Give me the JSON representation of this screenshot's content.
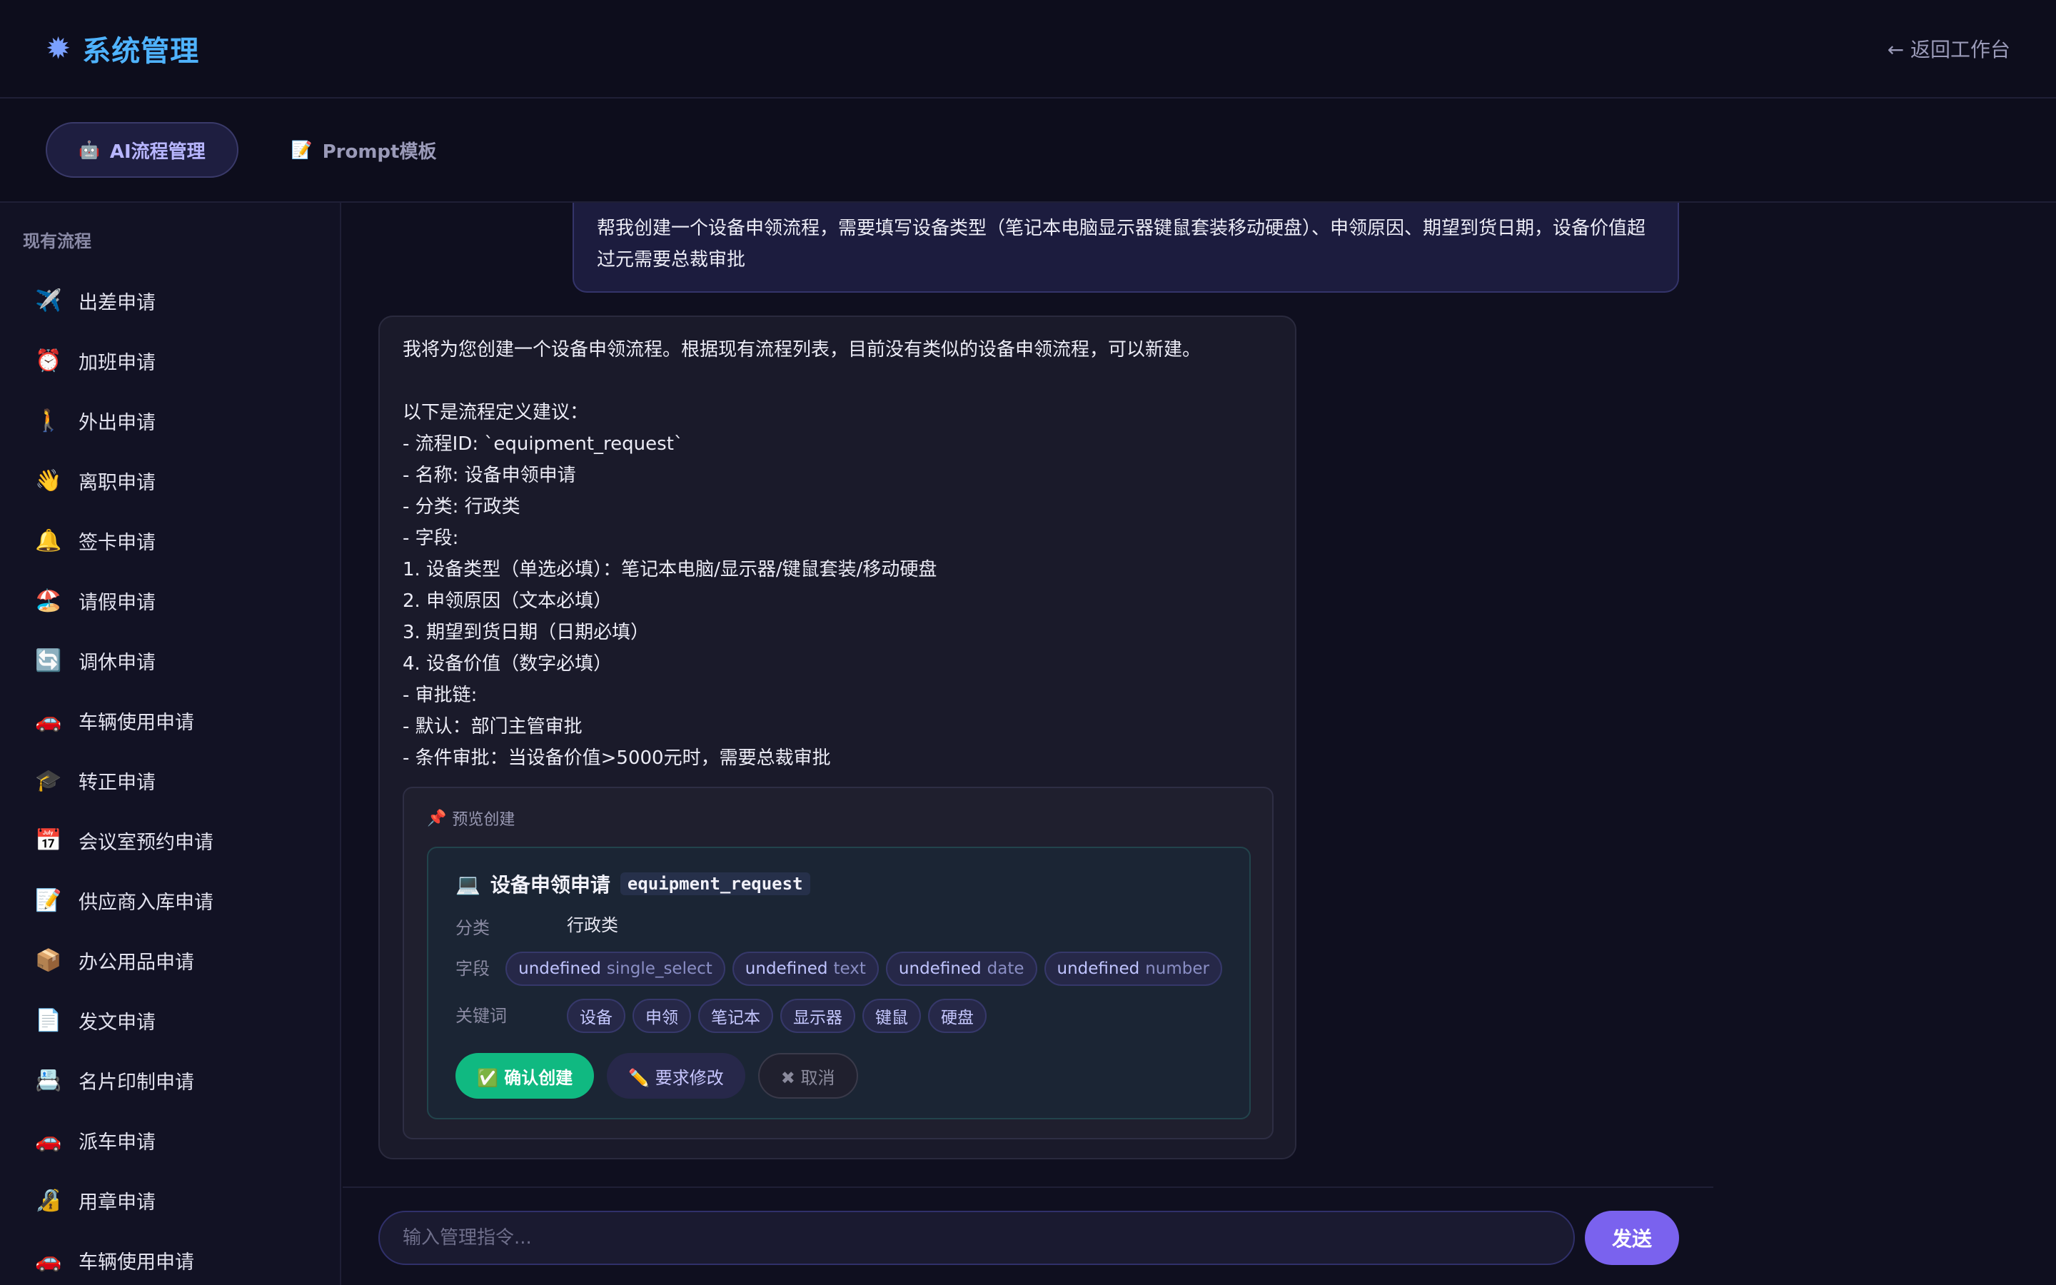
{
  "header": {
    "title": "系统管理",
    "back_label": "← 返回工作台"
  },
  "tabs": [
    {
      "icon": "🤖",
      "label": "AI流程管理",
      "active": true
    },
    {
      "icon": "📝",
      "label": "Prompt模板",
      "active": false
    }
  ],
  "sidebar": {
    "heading": "现有流程",
    "items": [
      {
        "icon": "✈️",
        "label": "出差申请"
      },
      {
        "icon": "⏰",
        "label": "加班申请"
      },
      {
        "icon": "🚶",
        "label": "外出申请"
      },
      {
        "icon": "👋",
        "label": "离职申请"
      },
      {
        "icon": "🔔",
        "label": "签卡申请"
      },
      {
        "icon": "🏖️",
        "label": "请假申请"
      },
      {
        "icon": "🔄",
        "label": "调休申请"
      },
      {
        "icon": "🚗",
        "label": "车辆使用申请"
      },
      {
        "icon": "🎓",
        "label": "转正申请"
      },
      {
        "icon": "📅",
        "label": "会议室预约申请"
      },
      {
        "icon": "📝",
        "label": "供应商入库申请"
      },
      {
        "icon": "📦",
        "label": "办公用品申请"
      },
      {
        "icon": "📄",
        "label": "发文申请"
      },
      {
        "icon": "📇",
        "label": "名片印制申请"
      },
      {
        "icon": "🚗",
        "label": "派车申请"
      },
      {
        "icon": "🔏",
        "label": "用章申请"
      },
      {
        "icon": "🚗",
        "label": "车辆使用申请"
      }
    ]
  },
  "chat": {
    "user_message": "帮我创建一个设备申领流程，需要填写设备类型（笔记本电脑显示器键鼠套装移动硬盘）、申领原因、期望到货日期，设备价值超过元需要总裁审批",
    "ai_message": "我将为您创建一个设备申领流程。根据现有流程列表，目前没有类似的设备申领流程，可以新建。\n\n以下是流程定义建议：\n- 流程ID: `equipment_request`\n- 名称: 设备申领申请\n- 分类: 行政类\n- 字段:\n1. 设备类型（单选必填）：笔记本电脑/显示器/键鼠套装/移动硬盘\n2. 申领原因（文本必填）\n3. 期望到货日期（日期必填）\n4. 设备价值（数字必填）\n- 审批链:\n- 默认：部门主管审批\n- 条件审批：当设备价值>5000元时，需要总裁审批",
    "preview": {
      "heading_icon": "📌",
      "heading": "预览创建",
      "card_icon": "💻",
      "name": "设备申领申请",
      "code": "equipment_request",
      "category_label": "分类",
      "category": "行政类",
      "fields_label": "字段",
      "fields": [
        {
          "name": "undefined",
          "type": "single_select"
        },
        {
          "name": "undefined",
          "type": "text"
        },
        {
          "name": "undefined",
          "type": "date"
        },
        {
          "name": "undefined",
          "type": "number"
        }
      ],
      "keywords_label": "关键词",
      "keywords": [
        "设备",
        "申领",
        "笔记本",
        "显示器",
        "键鼠",
        "硬盘"
      ],
      "confirm_label": "✅ 确认创建",
      "modify_label": "✏️ 要求修改",
      "cancel_label": "✖ 取消"
    }
  },
  "input": {
    "placeholder": "输入管理指令...",
    "send_label": "发送"
  },
  "colors": {
    "background": "#0f0f1f",
    "accent": "#7a62ee",
    "title_blue": "#4fb3ff",
    "confirm_green": "#10b981"
  }
}
